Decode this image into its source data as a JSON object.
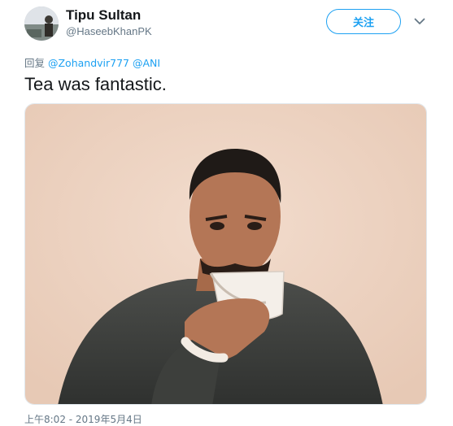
{
  "author": {
    "display_name": "Tipu Sultan",
    "screen_name": "@HaseebKhanPK"
  },
  "follow_button": {
    "label": "关注"
  },
  "reply": {
    "prefix": "回复 ",
    "mentions": [
      "@Zohandvir777",
      "@ANI"
    ]
  },
  "tweet": {
    "text": "Tea was fantastic."
  },
  "timestamp": "上午8:02 - 2019年5月4日",
  "colors": {
    "accent": "#1da1f2",
    "text_primary": "#14171a",
    "text_secondary": "#657786",
    "border": "#e1e8ed"
  },
  "icons": {
    "more_menu": "chevron-down-icon"
  }
}
